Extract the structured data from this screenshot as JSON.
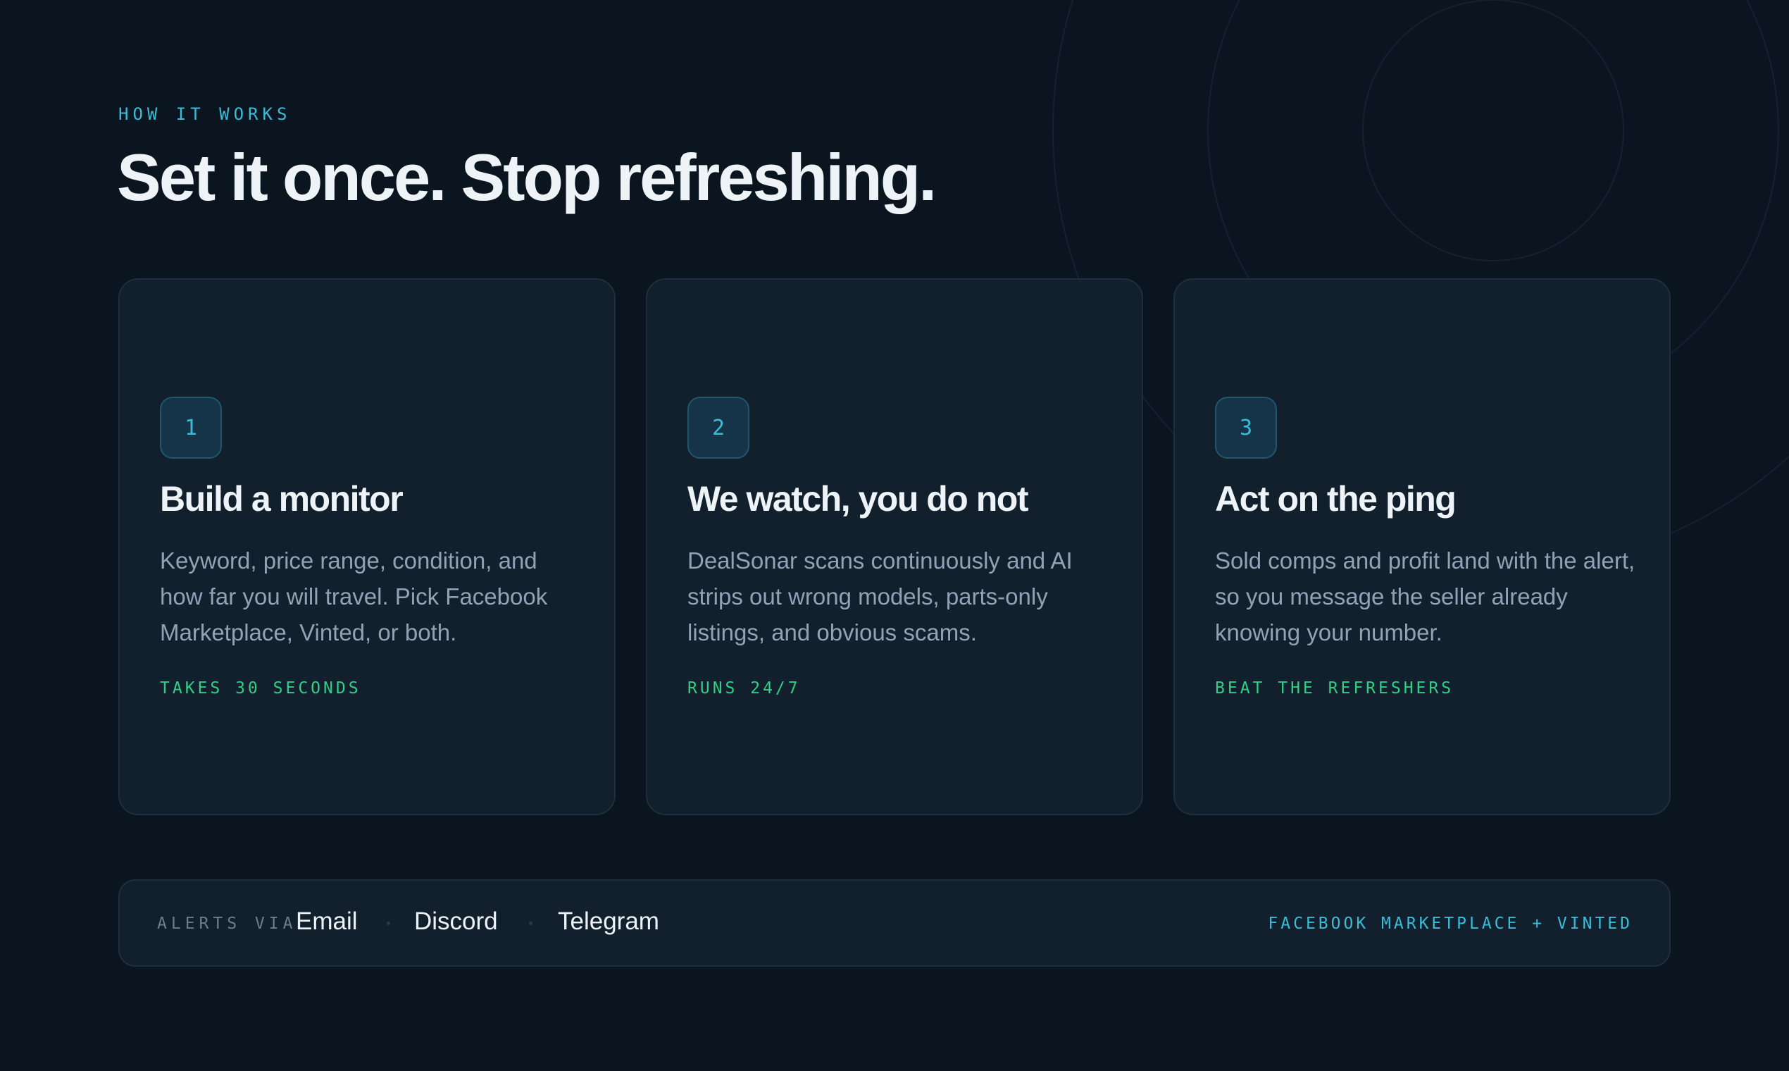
{
  "section": {
    "eyebrow": "HOW IT WORKS",
    "headline": "Set it once. Stop refreshing."
  },
  "steps": [
    {
      "number": "1",
      "title": "Build a monitor",
      "body": "Keyword, price range, condition, and how far you will travel. Pick Facebook Marketplace, Vinted, or both.",
      "tag": "TAKES 30 SECONDS"
    },
    {
      "number": "2",
      "title": "We watch, you do not",
      "body": "DealSonar scans continuously and AI strips out wrong models, parts-only listings, and obvious scams.",
      "tag": "RUNS 24/7"
    },
    {
      "number": "3",
      "title": "Act on the ping",
      "body": "Sold comps and profit land with the alert, so you message the seller already knowing your number.",
      "tag": "BEAT THE REFRESHERS"
    }
  ],
  "footer": {
    "alerts_label": "ALERTS VIA",
    "channels": [
      "Email",
      "Discord",
      "Telegram"
    ],
    "platforms": "FACEBOOK MARKETPLACE + VINTED"
  },
  "colors": {
    "background": "#0b1520",
    "card": "#12202d",
    "accent_cyan": "#3bbcd6",
    "accent_green": "#2fcf86",
    "text_primary": "#eef3f8",
    "text_muted": "#90a2b3"
  },
  "icons": [
    "sonar-rings-decoration"
  ]
}
